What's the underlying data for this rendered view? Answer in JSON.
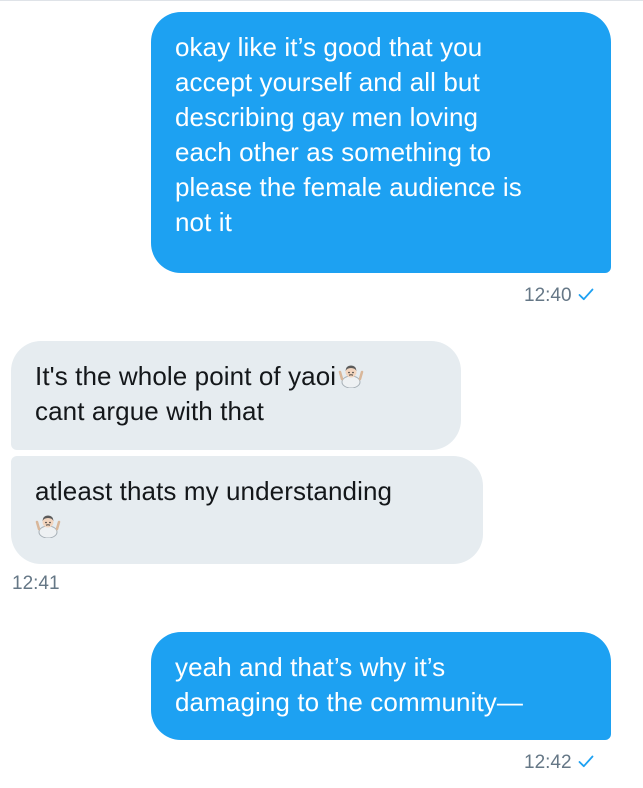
{
  "messages": [
    {
      "direction": "sent",
      "lines": [
        "okay like it’s good that you",
        "accept yourself and all but",
        "describing gay men loving",
        "each other as something to",
        "please the female audience is",
        "not it"
      ],
      "time": "12:40"
    },
    {
      "direction": "received",
      "lines": [
        "It's the whole point of yaoi",
        "cant argue with that"
      ],
      "emoji": "man-shrugging"
    },
    {
      "direction": "received",
      "lines": [
        "atleast thats my understanding"
      ],
      "emoji": "man-shrugging",
      "time": "12:41"
    },
    {
      "direction": "sent",
      "lines": [
        "yeah and that’s why it’s",
        "damaging to the community—"
      ],
      "time": "12:42"
    }
  ],
  "colors": {
    "sent_bubble": "#1da1f2",
    "received_bubble": "#e6ecf0",
    "meta_text": "#657786",
    "read_check": "#1da1f2"
  },
  "icons": {
    "read_receipt": "checkmark-icon",
    "emoji": "man-shrugging-emoji"
  }
}
